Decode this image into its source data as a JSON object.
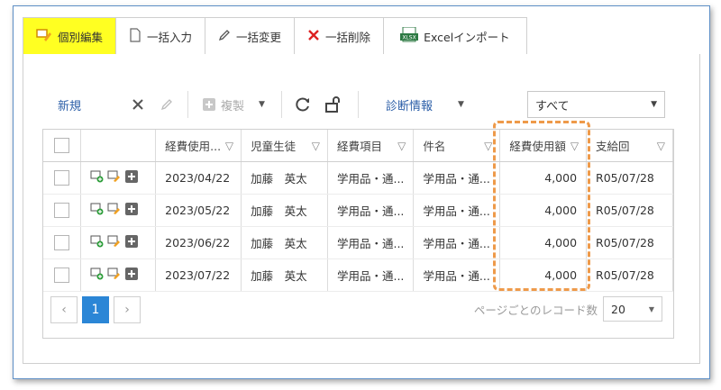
{
  "tabs": [
    {
      "label": "個別編集",
      "icon": "edit-single-icon",
      "active": true
    },
    {
      "label": "一括入力",
      "icon": "document-icon",
      "active": false
    },
    {
      "label": "一括変更",
      "icon": "pencil-icon",
      "active": false
    },
    {
      "label": "一括削除",
      "icon": "delete-x-icon",
      "active": false
    },
    {
      "label": "Excelインポート",
      "icon": "xlsx-icon",
      "active": false
    }
  ],
  "toolbar": {
    "new_label": "新規",
    "copy_label": "複製",
    "diagnostics_label": "診断情報",
    "filter_select_value": "すべて"
  },
  "table": {
    "columns": [
      "経費使用...",
      "児童生徒",
      "経費項目",
      "件名",
      "経費使用額",
      "支給回"
    ],
    "rows": [
      {
        "date": "2023/04/22",
        "student": "加藤　英太",
        "item": "学用品・通...",
        "subject": "学用品・通...",
        "amount": "4,000",
        "payment": "R05/07/28"
      },
      {
        "date": "2023/05/22",
        "student": "加藤　英太",
        "item": "学用品・通...",
        "subject": "学用品・通...",
        "amount": "4,000",
        "payment": "R05/07/28"
      },
      {
        "date": "2023/06/22",
        "student": "加藤　英太",
        "item": "学用品・通...",
        "subject": "学用品・通...",
        "amount": "4,000",
        "payment": "R05/07/28"
      },
      {
        "date": "2023/07/22",
        "student": "加藤　英太",
        "item": "学用品・通...",
        "subject": "学用品・通...",
        "amount": "4,000",
        "payment": "R05/07/28"
      }
    ]
  },
  "pager": {
    "current_page": "1",
    "per_page_label": "ページごとのレコード数",
    "per_page_value": "20"
  },
  "colors": {
    "active_tab": "#ffff22",
    "link": "#2c5fa8",
    "page_active": "#2b86d6",
    "highlight": "#ee9a4a"
  }
}
